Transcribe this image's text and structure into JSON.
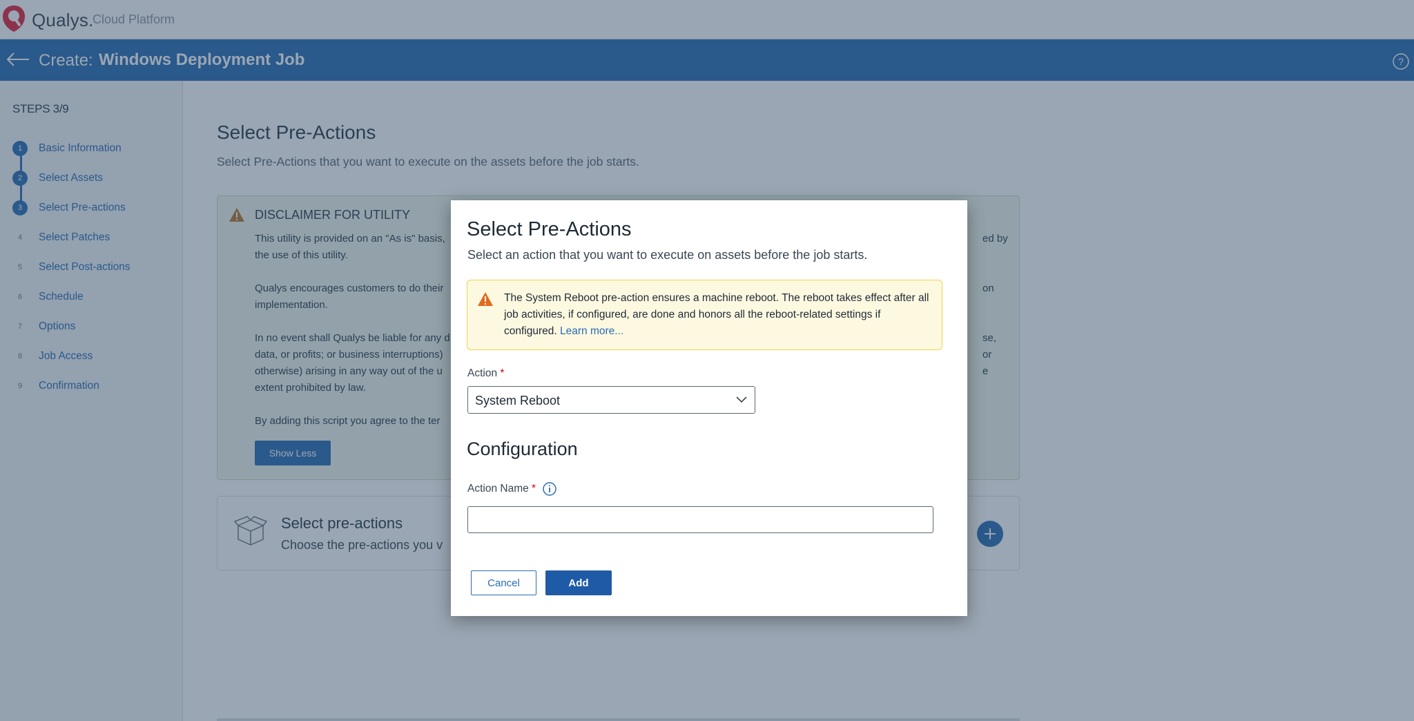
{
  "app": {
    "brand": "Qualys.",
    "brand_sub": "Cloud Platform"
  },
  "header": {
    "create_label": "Create:",
    "job_title": "Windows Deployment Job"
  },
  "sidebar": {
    "steps_title": "STEPS 3/9",
    "steps": [
      {
        "num": "1",
        "label": "Basic Information"
      },
      {
        "num": "2",
        "label": "Select Assets"
      },
      {
        "num": "3",
        "label": "Select Pre-actions"
      },
      {
        "num": "4",
        "label": "Select Patches"
      },
      {
        "num": "5",
        "label": "Select Post-actions"
      },
      {
        "num": "6",
        "label": "Schedule"
      },
      {
        "num": "7",
        "label": "Options"
      },
      {
        "num": "8",
        "label": "Job Access"
      },
      {
        "num": "9",
        "label": "Confirmation"
      }
    ]
  },
  "main": {
    "title": "Select Pre-Actions",
    "subtitle": "Select Pre-Actions that you want to execute on the assets before the job starts.",
    "disclaimer": {
      "title": "DISCLAIMER FOR UTILITY",
      "lines": [
        "This utility is provided on an \"As is\" basis,",
        "ed by",
        "the use of this utility.",
        "Qualys encourages customers to do their",
        "on",
        "implementation.",
        "In no event shall Qualys be liable for any d",
        "se,",
        "data, or profits; or business interruptions)",
        "or",
        "otherwise) arising in any way out of the u",
        "e",
        "extent prohibited by law.",
        "By adding this script you agree to the ter"
      ],
      "show_less": "Show Less"
    },
    "preactions_card": {
      "title": "Select pre-actions",
      "subtitle": "Choose the pre-actions you v"
    }
  },
  "modal": {
    "title": "Select Pre-Actions",
    "subtitle": "Select an action that you want to execute on assets before the job starts.",
    "alert_text": "The System Reboot pre-action ensures a machine reboot. The reboot takes effect after all job activities, if configured, are done and honors all the reboot-related settings if configured.",
    "alert_link": "Learn more...",
    "action_label": "Action",
    "required_mark": "*",
    "action_value": "System Reboot",
    "config_title": "Configuration",
    "action_name_label": "Action Name",
    "action_name_value": "",
    "cancel": "Cancel",
    "add": "Add"
  },
  "colors": {
    "accent": "#2a6bb3",
    "required": "#d0021b",
    "warning": "#e06c1f"
  }
}
